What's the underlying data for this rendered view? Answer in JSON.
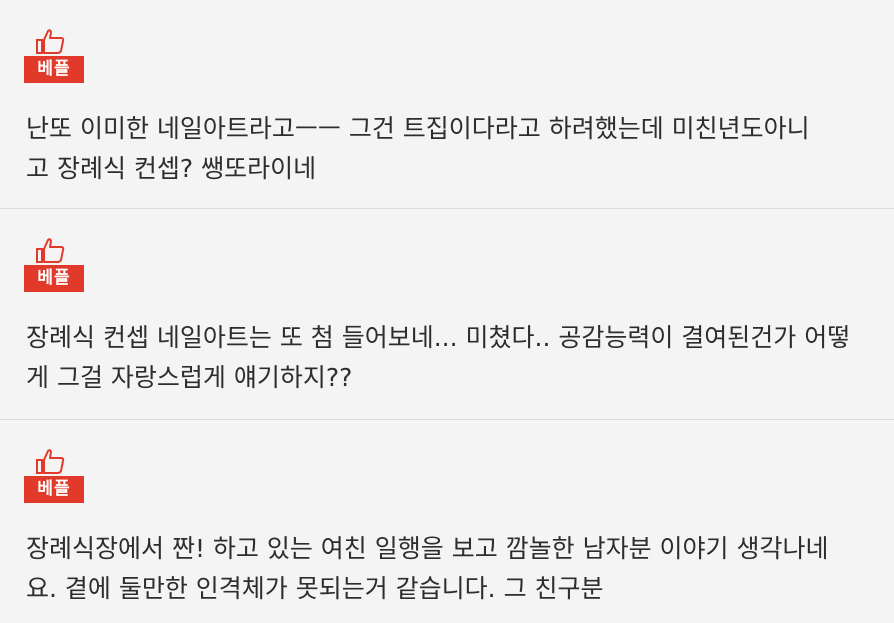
{
  "colors": {
    "badge_bg": "#e23a2a",
    "badge_text": "#ffffff",
    "card_bg": "#f4f4f4",
    "divider": "#dcdcdc",
    "text": "#2d2d2d"
  },
  "comments": [
    {
      "badge_icon": "thumbs-up-icon",
      "badge": "베플",
      "lines": [
        "난또 이미한 네일아트라고ㅡㅡ 그건 트집이다라고 하려했는데 미친년도아니",
        "고 장례식 컨셉? 쌩또라이네"
      ]
    },
    {
      "badge_icon": "thumbs-up-icon",
      "badge": "베플",
      "lines": [
        "장례식 컨셉 네일아트는 또 첨 들어보네... 미쳤다.. 공감능력이 결여된건가 어떻",
        "게 그걸 자랑스럽게 얘기하지??"
      ]
    },
    {
      "badge_icon": "thumbs-up-icon",
      "badge": "베플",
      "lines": [
        "장례식장에서 짠! 하고 있는 여친 일행을 보고 깜놀한 남자분 이야기 생각나네",
        "요. 곁에 둘만한 인격체가 못되는거 같습니다. 그 친구분"
      ]
    }
  ]
}
